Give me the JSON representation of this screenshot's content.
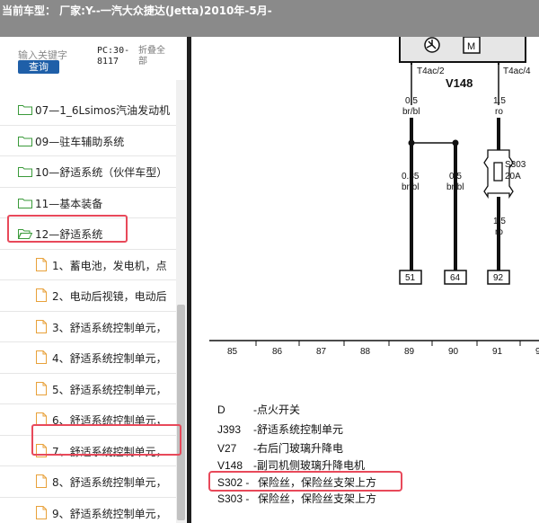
{
  "title": "当前车型： 厂家:Y--一汽大众捷达(Jetta)2010年-5月-",
  "search": {
    "label": "输入关键字",
    "button": "查询",
    "pc": "PC:30-8117",
    "fold": "折叠全部"
  },
  "tree": {
    "folders": [
      "07—1_6Lsimos汽油发动机",
      "09—驻车辅助系统",
      "10—舒适系统（伙伴车型）",
      "11—基本装备",
      "12—舒适系统"
    ],
    "documents": [
      "1、蓄电池，发电机，点",
      "2、电动后视镜，电动后",
      "3、舒适系统控制单元，",
      "4、舒适系统控制单元，",
      "5、舒适系统控制单元，",
      "6、舒适系统控制单元，",
      "7、舒适系统控制单元，",
      "8、舒适系统控制单元，",
      "9、舒适系统控制单元，"
    ],
    "selected_folder": "12—舒适系统",
    "selected_document": "7、舒适系统控制单元，"
  },
  "diagram": {
    "top_labels": {
      "left": "T4ac/2",
      "right": "T4ac/4",
      "component": "V148"
    },
    "wires": [
      {
        "gauge": "0.5",
        "color": "br/bl"
      },
      {
        "gauge": "1.5",
        "color": "ro"
      },
      {
        "gauge": "0.35",
        "color": "br/bl"
      },
      {
        "gauge": "0.5",
        "color": "br/bl"
      },
      {
        "gauge": "1.5",
        "color": "ro"
      }
    ],
    "fuse": {
      "name": "S303",
      "rating": "20A"
    },
    "terminals": [
      "51",
      "64",
      "92"
    ],
    "ruler": [
      "85",
      "86",
      "87",
      "88",
      "89",
      "90",
      "91",
      "9"
    ],
    "legend": [
      {
        "code": "D",
        "desc": "-点火开关"
      },
      {
        "code": "J393",
        "desc": "-舒适系统控制单元"
      },
      {
        "code": "V27",
        "desc": "-右后门玻璃升降电"
      },
      {
        "code": "V148",
        "desc": "-副司机侧玻璃升降电机"
      },
      {
        "code": "S302 -",
        "desc": "保险丝，保险丝支架上方"
      },
      {
        "code": "S303 -",
        "desc": "保险丝，保险丝支架上方"
      }
    ],
    "highlighted_legend": "S302 -"
  }
}
